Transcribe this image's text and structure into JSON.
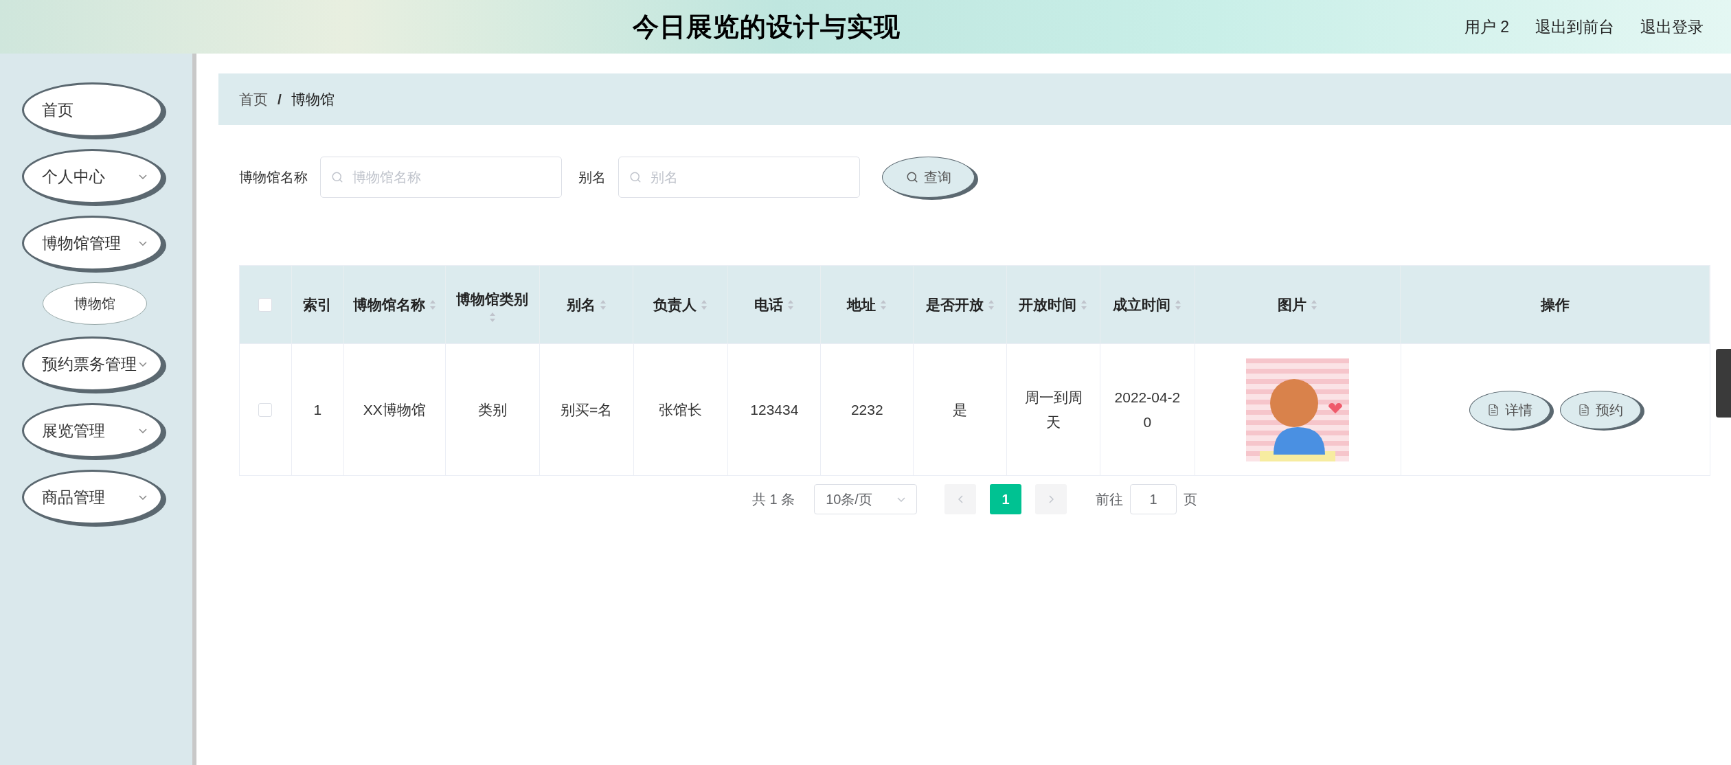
{
  "header": {
    "title": "今日展览的设计与实现",
    "links": [
      "用户 2",
      "退出到前台",
      "退出登录"
    ]
  },
  "sidebar": {
    "items": [
      {
        "label": "首页",
        "kind": "link"
      },
      {
        "label": "个人中心",
        "kind": "group"
      },
      {
        "label": "博物馆管理",
        "kind": "group",
        "children": [
          {
            "label": "博物馆"
          }
        ]
      },
      {
        "label": "预约票务管理",
        "kind": "group"
      },
      {
        "label": "展览管理",
        "kind": "group"
      },
      {
        "label": "商品管理",
        "kind": "group"
      }
    ]
  },
  "breadcrumb": [
    "首页",
    "博物馆"
  ],
  "breadcrumb_separator": "/",
  "search": {
    "fields": [
      {
        "label": "博物馆名称",
        "placeholder": "博物馆名称"
      },
      {
        "label": "别名",
        "placeholder": "别名"
      }
    ],
    "button": "查询"
  },
  "table": {
    "select_all": {
      "checked": false
    },
    "columns": [
      {
        "label": "索引",
        "sortable": false
      },
      {
        "label": "博物馆名称",
        "sortable": true
      },
      {
        "label": "博物馆类别",
        "sortable": true
      },
      {
        "label": "别名",
        "sortable": true
      },
      {
        "label": "负责人",
        "sortable": true
      },
      {
        "label": "电话",
        "sortable": true
      },
      {
        "label": "地址",
        "sortable": true
      },
      {
        "label": "是否开放",
        "sortable": true
      },
      {
        "label": "开放时间",
        "sortable": true
      },
      {
        "label": "成立时间",
        "sortable": true
      },
      {
        "label": "图片",
        "sortable": true
      },
      {
        "label": "操作",
        "sortable": false
      }
    ],
    "rows": [
      {
        "checked": false,
        "cells": [
          "1",
          "XX博物馆",
          "类别",
          "别买=名",
          "张馆长",
          "123434",
          "2232",
          "是",
          "周一到周天",
          "2022-04-20"
        ],
        "actions": [
          "详情",
          "预约"
        ]
      }
    ]
  },
  "pagination": {
    "total": "共 1 条",
    "page_size": "10条/页",
    "pages": [
      {
        "label": "1",
        "selected": true
      }
    ],
    "goto_label": "前往",
    "goto_value": "1",
    "goto_suffix": "页"
  }
}
